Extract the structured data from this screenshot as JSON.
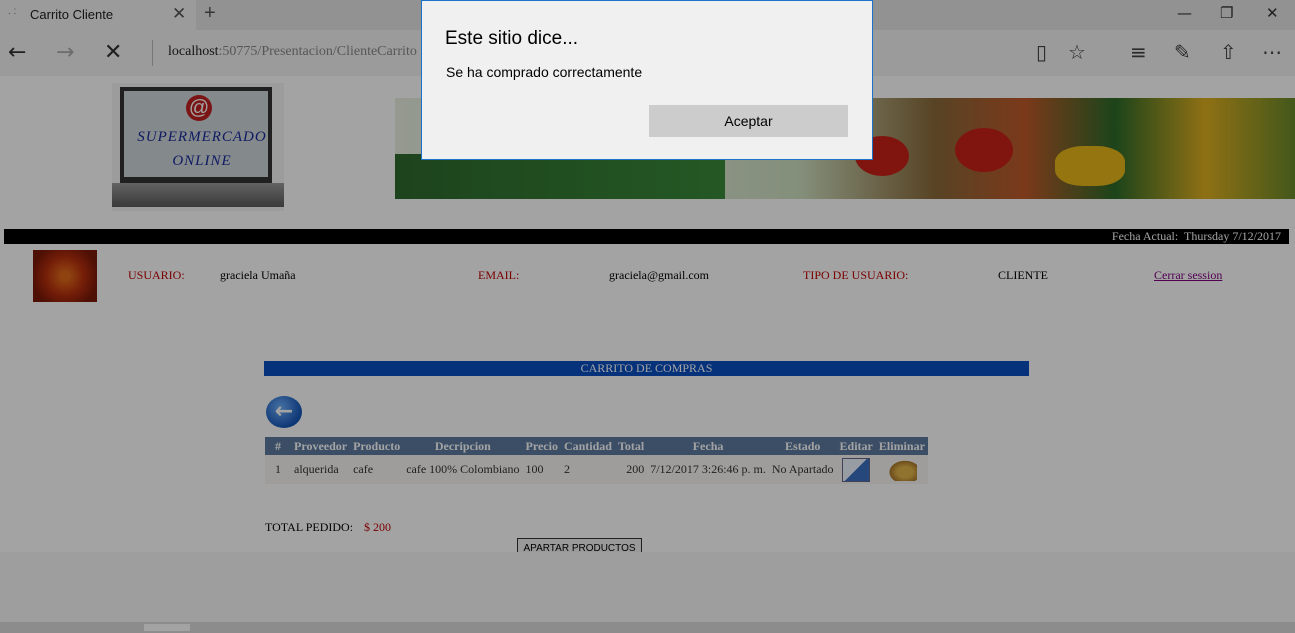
{
  "browser": {
    "tab_title": "Carrito Cliente",
    "tab_close": "✕",
    "new_tab": "+",
    "url_host": "localhost",
    "url_rest": ":50775/Presentacion/ClienteCarrito",
    "icons": [
      "back-arrow-icon",
      "forward-arrow-icon",
      "stop-icon",
      "reading-view-icon",
      "favorite-star-icon",
      "hub-icon",
      "web-note-icon",
      "share-icon",
      "more-icon"
    ]
  },
  "header": {
    "logo_text_line1": "SUPERMERCADO",
    "logo_text_line2": "ONLINE",
    "logo_at": "@",
    "date_label": "Fecha Actual:",
    "date_value": "Thursday 7/12/2017"
  },
  "user": {
    "usuario_label": "USUARIO:",
    "usuario_value": "graciela Umaña",
    "email_label": "EMAIL:",
    "email_value": "graciela@gmail.com",
    "tipo_label": "TIPO DE USUARIO:",
    "tipo_value": "CLIENTE",
    "logout": "Cerrar session"
  },
  "cart": {
    "title": "CARRITO DE COMPRAS",
    "columns": [
      "#",
      "Proveedor",
      "Producto",
      "Decripcion",
      "Precio",
      "Cantidad",
      "Total",
      "Fecha",
      "Estado",
      "Editar",
      "Eliminar"
    ],
    "rows": [
      {
        "num": "1",
        "proveedor": "alquerida",
        "producto": "cafe",
        "descripcion": "cafe 100% Colombiano",
        "precio": "100",
        "cantidad": "2",
        "total": "200",
        "fecha": "7/12/2017 3:26:46 p. m.",
        "estado": "No Apartado"
      }
    ],
    "total_label": "TOTAL PEDIDO:",
    "total_value": "$ 200",
    "apartar_button": "APARTAR PRODUCTOS"
  },
  "dialog": {
    "title": "Este sitio dice...",
    "message": "Se ha comprado correctamente",
    "ok_button": "Aceptar"
  },
  "colors": {
    "blue_bar": "#0a4fc0",
    "table_header": "#5e7ba0",
    "label_red": "#c00000",
    "dialog_border": "#1a73c8"
  }
}
